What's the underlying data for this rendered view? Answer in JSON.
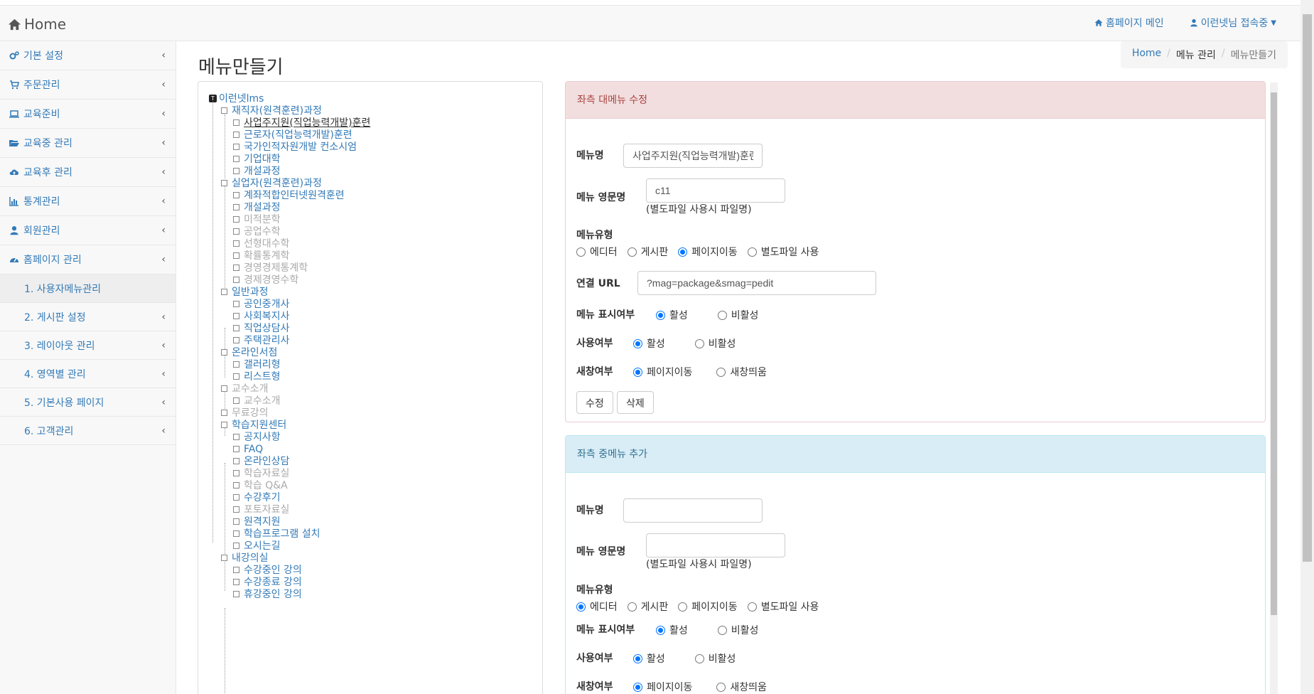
{
  "brand": {
    "title": "Home"
  },
  "topnav": {
    "home_link": "홈페이지 메인",
    "user": "이런넷님 접속중"
  },
  "sidebar": {
    "items": [
      {
        "label": "기본 설정"
      },
      {
        "label": "주문관리"
      },
      {
        "label": "교육준비"
      },
      {
        "label": "교육중 관리"
      },
      {
        "label": "교육후 관리"
      },
      {
        "label": "통계관리"
      },
      {
        "label": "회원관리"
      },
      {
        "label": "홈페이지 관리"
      }
    ],
    "subitems": [
      {
        "label": "1. 사용자메뉴관리"
      },
      {
        "label": "2. 게시판 설정"
      },
      {
        "label": "3. 레이아웃 관리"
      },
      {
        "label": "4. 영역별 관리"
      },
      {
        "label": "5. 기본사용 페이지"
      },
      {
        "label": "6. 고객관리"
      }
    ]
  },
  "page": {
    "title": "메뉴만들기"
  },
  "breadcrumb": {
    "home": "Home",
    "section": "메뉴 관리",
    "current": "메뉴만들기"
  },
  "tree": {
    "root": "이런넷lms",
    "root_icon_letter": "T",
    "nodes": [
      {
        "label": "재직자(원격훈련)과정"
      },
      {
        "label": "사업주지원(직업능력개발)훈련"
      },
      {
        "label": "근로자(직업능력개발)훈련"
      },
      {
        "label": "국가인적자원개발 컨소시엄"
      },
      {
        "label": "기업대학"
      },
      {
        "label": "개설과정"
      },
      {
        "label": "실업자(원격훈련)과정"
      },
      {
        "label": "계좌적합인터넷원격훈련"
      },
      {
        "label": "개설과정"
      },
      {
        "label": "미적분학"
      },
      {
        "label": "공업수학"
      },
      {
        "label": "선형대수학"
      },
      {
        "label": "확률통계학"
      },
      {
        "label": "경영경제통계학"
      },
      {
        "label": "경제경영수학"
      },
      {
        "label": "일반과정"
      },
      {
        "label": "공인중개사"
      },
      {
        "label": "사회복지사"
      },
      {
        "label": "직업상담사"
      },
      {
        "label": "주택관리사"
      },
      {
        "label": "온라인서점"
      },
      {
        "label": "갤러리형"
      },
      {
        "label": "리스트형"
      },
      {
        "label": "교수소개"
      },
      {
        "label": "교수소개"
      },
      {
        "label": "무료강의"
      },
      {
        "label": "학습지원센터"
      },
      {
        "label": "공지사항"
      },
      {
        "label": "FAQ"
      },
      {
        "label": "온라인상담"
      },
      {
        "label": "학습자료실"
      },
      {
        "label": "학습 Q&A"
      },
      {
        "label": "수강후기"
      },
      {
        "label": "포토자료실"
      },
      {
        "label": "원격지원"
      },
      {
        "label": "학습프로그램 설치"
      },
      {
        "label": "오시는길"
      },
      {
        "label": "내강의실"
      },
      {
        "label": "수강중인 강의"
      },
      {
        "label": "수강종료 강의"
      },
      {
        "label": "휴강중인 강의"
      }
    ]
  },
  "edit_panel": {
    "heading": "좌측 대메뉴 수정",
    "menu_name_label": "메뉴명",
    "menu_name_value": "사업주지원(직업능력개발)훈련",
    "eng_label": "메뉴 영문명",
    "eng_value": "c11",
    "eng_help": "(별도파일 사용시 파일명)",
    "type_label": "메뉴유형",
    "types": [
      "에디터",
      "게시판",
      "페이지이동",
      "별도파일 사용"
    ],
    "type_selected": "페이지이동",
    "url_label": "연결 URL",
    "url_value": "?mag=package&smag=pedit",
    "display_label": "메뉴 표시여부",
    "use_label": "사용여부",
    "on": "활성",
    "off": "비활성",
    "display_selected": "활성",
    "use_selected": "활성",
    "window_label": "새창여부",
    "window_opts": [
      "페이지이동",
      "새창띄움"
    ],
    "window_selected": "페이지이동",
    "update_btn": "수정",
    "delete_btn": "삭제"
  },
  "add_panel": {
    "heading": "좌측 중메뉴 추가",
    "menu_name_label": "메뉴명",
    "menu_name_value": "",
    "eng_label": "메뉴 영문명",
    "eng_value": "",
    "eng_help": "(별도파일 사용시 파일명)",
    "type_label": "메뉴유형",
    "type_selected": "에디터",
    "display_label": "메뉴 표시여부",
    "use_label": "사용여부",
    "window_label": "새창여부",
    "display_selected": "활성",
    "use_selected": "활성",
    "window_selected": "페이지이동"
  }
}
